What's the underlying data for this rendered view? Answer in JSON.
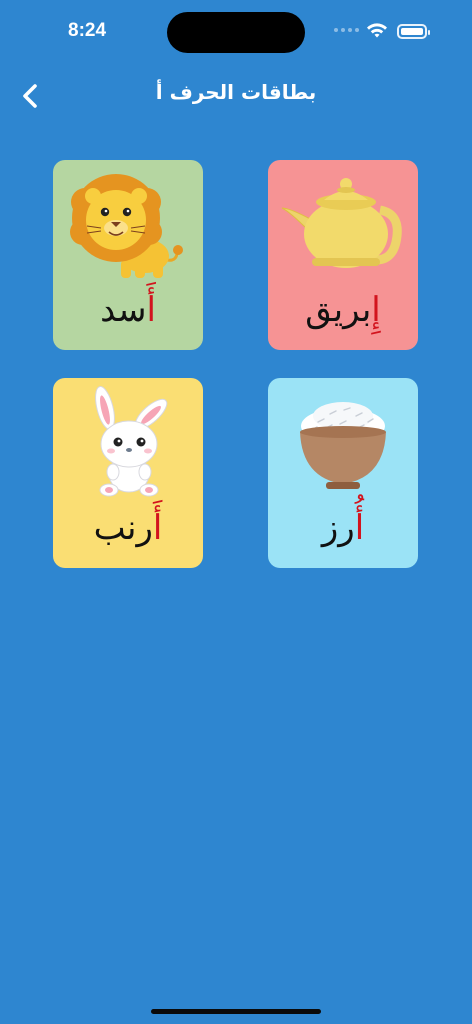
{
  "status_bar": {
    "time": "8:24"
  },
  "nav": {
    "title": "بطاقات الحرف أ",
    "back_icon": "chevron-left-icon"
  },
  "cards": [
    {
      "id": "lion",
      "letter": "أَ",
      "rest": "سد",
      "image": "lion-icon",
      "bg": "#B5D6A1"
    },
    {
      "id": "teapot",
      "letter": "إِ",
      "rest": "بريق",
      "image": "teapot-icon",
      "bg": "#F69394"
    },
    {
      "id": "rabbit",
      "letter": "أَ",
      "rest": "رنب",
      "image": "rabbit-icon",
      "bg": "#FADE73"
    },
    {
      "id": "rice",
      "letter": "أُ",
      "rest": "رز",
      "image": "rice-bowl-icon",
      "bg": "#9BE3F6"
    }
  ],
  "colors": {
    "background": "#2E86D0",
    "letter_highlight": "#D2141E"
  }
}
